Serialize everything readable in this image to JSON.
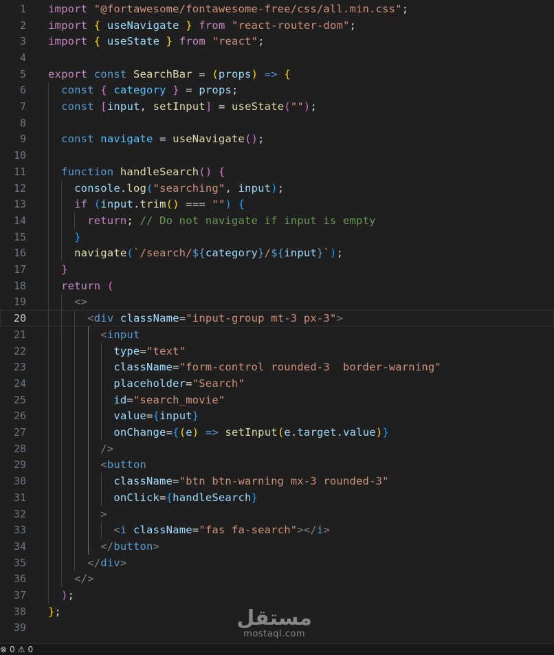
{
  "colors": {
    "keyword": "#c586c0",
    "storage": "#569cd6",
    "string": "#ce9178",
    "func": "#dcdcaa",
    "variable": "#9cdcfe",
    "constant": "#4fc1ff",
    "component": "#4ec9b0",
    "comment": "#6a9955",
    "punct": "#d4d4d4",
    "tag": "#808080",
    "bracket1": "#ffd700",
    "bracket2": "#da70d6",
    "bracket3": "#179fff",
    "attr": "#9cdcfe"
  },
  "lines": [
    {
      "n": "1",
      "t": [
        [
          "kw",
          "import"
        ],
        [
          "p",
          " "
        ],
        [
          "s",
          "\"@fortawesome/fontawesome-free/css/all.min.css\""
        ],
        [
          "p",
          ";"
        ]
      ]
    },
    {
      "n": "2",
      "t": [
        [
          "kw",
          "import"
        ],
        [
          "p",
          " "
        ],
        [
          "b1",
          "{"
        ],
        [
          "p",
          " "
        ],
        [
          "v",
          "useNavigate"
        ],
        [
          "p",
          " "
        ],
        [
          "b1",
          "}"
        ],
        [
          "p",
          " "
        ],
        [
          "kw",
          "from"
        ],
        [
          "p",
          " "
        ],
        [
          "s",
          "\"react-router-dom\""
        ],
        [
          "p",
          ";"
        ]
      ]
    },
    {
      "n": "3",
      "t": [
        [
          "kw",
          "import"
        ],
        [
          "p",
          " "
        ],
        [
          "b1",
          "{"
        ],
        [
          "p",
          " "
        ],
        [
          "v",
          "useState"
        ],
        [
          "p",
          " "
        ],
        [
          "b1",
          "}"
        ],
        [
          "p",
          " "
        ],
        [
          "kw",
          "from"
        ],
        [
          "p",
          " "
        ],
        [
          "s",
          "\"react\""
        ],
        [
          "p",
          ";"
        ]
      ]
    },
    {
      "n": "4",
      "t": []
    },
    {
      "n": "5",
      "t": [
        [
          "kw",
          "export"
        ],
        [
          "p",
          " "
        ],
        [
          "st",
          "const"
        ],
        [
          "p",
          " "
        ],
        [
          "fn",
          "SearchBar"
        ],
        [
          "p",
          " = "
        ],
        [
          "b1",
          "("
        ],
        [
          "v",
          "props"
        ],
        [
          "b1",
          ")"
        ],
        [
          "p",
          " "
        ],
        [
          "st",
          "=>"
        ],
        [
          "p",
          " "
        ],
        [
          "b1",
          "{"
        ]
      ]
    },
    {
      "n": "6",
      "t": [
        [
          "p",
          "  "
        ],
        [
          "st",
          "const"
        ],
        [
          "p",
          " "
        ],
        [
          "b2",
          "{"
        ],
        [
          "p",
          " "
        ],
        [
          "c",
          "category"
        ],
        [
          "p",
          " "
        ],
        [
          "b2",
          "}"
        ],
        [
          "p",
          " = "
        ],
        [
          "v",
          "props"
        ],
        [
          "p",
          ";"
        ]
      ]
    },
    {
      "n": "7",
      "t": [
        [
          "p",
          "  "
        ],
        [
          "st",
          "const"
        ],
        [
          "p",
          " "
        ],
        [
          "b2",
          "["
        ],
        [
          "v",
          "input"
        ],
        [
          "p",
          ", "
        ],
        [
          "fn",
          "setInput"
        ],
        [
          "b2",
          "]"
        ],
        [
          "p",
          " = "
        ],
        [
          "fn",
          "useState"
        ],
        [
          "b2",
          "("
        ],
        [
          "s",
          "\"\""
        ],
        [
          "b2",
          ")"
        ],
        [
          "p",
          ";"
        ]
      ]
    },
    {
      "n": "8",
      "t": []
    },
    {
      "n": "9",
      "t": [
        [
          "p",
          "  "
        ],
        [
          "st",
          "const"
        ],
        [
          "p",
          " "
        ],
        [
          "c",
          "navigate"
        ],
        [
          "p",
          " = "
        ],
        [
          "fn",
          "useNavigate"
        ],
        [
          "b2",
          "()"
        ],
        [
          "p",
          ";"
        ]
      ]
    },
    {
      "n": "10",
      "t": []
    },
    {
      "n": "11",
      "t": [
        [
          "p",
          "  "
        ],
        [
          "st",
          "function"
        ],
        [
          "p",
          " "
        ],
        [
          "fn",
          "handleSearch"
        ],
        [
          "b2",
          "()"
        ],
        [
          "p",
          " "
        ],
        [
          "b2",
          "{"
        ]
      ]
    },
    {
      "n": "12",
      "t": [
        [
          "p",
          "    "
        ],
        [
          "v",
          "console"
        ],
        [
          "p",
          "."
        ],
        [
          "fn",
          "log"
        ],
        [
          "b3",
          "("
        ],
        [
          "s",
          "\"searching\""
        ],
        [
          "p",
          ", "
        ],
        [
          "v",
          "input"
        ],
        [
          "b3",
          ")"
        ],
        [
          "p",
          ";"
        ]
      ]
    },
    {
      "n": "13",
      "t": [
        [
          "p",
          "    "
        ],
        [
          "kw",
          "if"
        ],
        [
          "p",
          " "
        ],
        [
          "b3",
          "("
        ],
        [
          "v",
          "input"
        ],
        [
          "p",
          "."
        ],
        [
          "fn",
          "trim"
        ],
        [
          "b1",
          "()"
        ],
        [
          "p",
          " === "
        ],
        [
          "s",
          "\"\""
        ],
        [
          "b3",
          ")"
        ],
        [
          "p",
          " "
        ],
        [
          "b3",
          "{"
        ]
      ]
    },
    {
      "n": "14",
      "t": [
        [
          "p",
          "      "
        ],
        [
          "kw",
          "return"
        ],
        [
          "p",
          "; "
        ],
        [
          "cm",
          "// Do not navigate if input is empty"
        ]
      ]
    },
    {
      "n": "15",
      "t": [
        [
          "p",
          "    "
        ],
        [
          "b3",
          "}"
        ]
      ]
    },
    {
      "n": "16",
      "t": [
        [
          "p",
          "    "
        ],
        [
          "fn",
          "navigate"
        ],
        [
          "b3",
          "("
        ],
        [
          "s",
          "`/search/"
        ],
        [
          "st",
          "${"
        ],
        [
          "v",
          "category"
        ],
        [
          "st",
          "}"
        ],
        [
          "s",
          "/"
        ],
        [
          "st",
          "${"
        ],
        [
          "v",
          "input"
        ],
        [
          "st",
          "}"
        ],
        [
          "s",
          "`"
        ],
        [
          "b3",
          ")"
        ],
        [
          "p",
          ";"
        ]
      ]
    },
    {
      "n": "17",
      "t": [
        [
          "p",
          "  "
        ],
        [
          "b2",
          "}"
        ]
      ]
    },
    {
      "n": "18",
      "t": [
        [
          "p",
          "  "
        ],
        [
          "kw",
          "return"
        ],
        [
          "p",
          " "
        ],
        [
          "b2",
          "("
        ]
      ]
    },
    {
      "n": "19",
      "t": [
        [
          "p",
          "    "
        ],
        [
          "tg",
          "<>"
        ]
      ]
    },
    {
      "n": "20",
      "t": [
        [
          "p",
          "      "
        ],
        [
          "tg",
          "<"
        ],
        [
          "st",
          "div"
        ],
        [
          "p",
          " "
        ],
        [
          "at",
          "className"
        ],
        [
          "p",
          "="
        ],
        [
          "s",
          "\"input-group mt-3 px-3\""
        ],
        [
          "tg",
          ">"
        ]
      ],
      "active": true
    },
    {
      "n": "21",
      "t": [
        [
          "p",
          "        "
        ],
        [
          "tg",
          "<"
        ],
        [
          "st",
          "input"
        ]
      ]
    },
    {
      "n": "22",
      "t": [
        [
          "p",
          "          "
        ],
        [
          "at",
          "type"
        ],
        [
          "p",
          "="
        ],
        [
          "s",
          "\"text\""
        ]
      ]
    },
    {
      "n": "23",
      "t": [
        [
          "p",
          "          "
        ],
        [
          "at",
          "className"
        ],
        [
          "p",
          "="
        ],
        [
          "s",
          "\"form-control rounded-3  border-warning\""
        ]
      ]
    },
    {
      "n": "24",
      "t": [
        [
          "p",
          "          "
        ],
        [
          "at",
          "placeholder"
        ],
        [
          "p",
          "="
        ],
        [
          "s",
          "\"Search\""
        ]
      ]
    },
    {
      "n": "25",
      "t": [
        [
          "p",
          "          "
        ],
        [
          "at",
          "id"
        ],
        [
          "p",
          "="
        ],
        [
          "s",
          "\"search_movie\""
        ]
      ]
    },
    {
      "n": "26",
      "t": [
        [
          "p",
          "          "
        ],
        [
          "at",
          "value"
        ],
        [
          "p",
          "="
        ],
        [
          "b3",
          "{"
        ],
        [
          "v",
          "input"
        ],
        [
          "b3",
          "}"
        ]
      ]
    },
    {
      "n": "27",
      "t": [
        [
          "p",
          "          "
        ],
        [
          "at",
          "onChange"
        ],
        [
          "p",
          "="
        ],
        [
          "b3",
          "{"
        ],
        [
          "b1",
          "("
        ],
        [
          "v",
          "e"
        ],
        [
          "b1",
          ")"
        ],
        [
          "p",
          " "
        ],
        [
          "st",
          "=>"
        ],
        [
          "p",
          " "
        ],
        [
          "fn",
          "setInput"
        ],
        [
          "b1",
          "("
        ],
        [
          "v",
          "e"
        ],
        [
          "p",
          "."
        ],
        [
          "v",
          "target"
        ],
        [
          "p",
          "."
        ],
        [
          "v",
          "value"
        ],
        [
          "b1",
          ")"
        ],
        [
          "b3",
          "}"
        ]
      ]
    },
    {
      "n": "28",
      "t": [
        [
          "p",
          "        "
        ],
        [
          "tg",
          "/>"
        ]
      ]
    },
    {
      "n": "29",
      "t": [
        [
          "p",
          "        "
        ],
        [
          "tg",
          "<"
        ],
        [
          "st",
          "button"
        ]
      ]
    },
    {
      "n": "30",
      "t": [
        [
          "p",
          "          "
        ],
        [
          "at",
          "className"
        ],
        [
          "p",
          "="
        ],
        [
          "s",
          "\"btn btn-warning mx-3 rounded-3\""
        ]
      ]
    },
    {
      "n": "31",
      "t": [
        [
          "p",
          "          "
        ],
        [
          "at",
          "onClick"
        ],
        [
          "p",
          "="
        ],
        [
          "b3",
          "{"
        ],
        [
          "v",
          "handleSearch"
        ],
        [
          "b3",
          "}"
        ]
      ]
    },
    {
      "n": "32",
      "t": [
        [
          "p",
          "        "
        ],
        [
          "tg",
          ">"
        ]
      ]
    },
    {
      "n": "33",
      "t": [
        [
          "p",
          "          "
        ],
        [
          "tg",
          "<"
        ],
        [
          "st",
          "i"
        ],
        [
          "p",
          " "
        ],
        [
          "at",
          "className"
        ],
        [
          "p",
          "="
        ],
        [
          "s",
          "\"fas fa-search\""
        ],
        [
          "tg",
          "></"
        ],
        [
          "st",
          "i"
        ],
        [
          "tg",
          ">"
        ]
      ]
    },
    {
      "n": "34",
      "t": [
        [
          "p",
          "        "
        ],
        [
          "tg",
          "</"
        ],
        [
          "st",
          "button"
        ],
        [
          "tg",
          ">"
        ]
      ]
    },
    {
      "n": "35",
      "t": [
        [
          "p",
          "      "
        ],
        [
          "tg",
          "</"
        ],
        [
          "st",
          "div"
        ],
        [
          "tg",
          ">"
        ]
      ]
    },
    {
      "n": "36",
      "t": [
        [
          "p",
          "    "
        ],
        [
          "tg",
          "</>"
        ]
      ]
    },
    {
      "n": "37",
      "t": [
        [
          "p",
          "  "
        ],
        [
          "b2",
          ")"
        ],
        [
          "p",
          ";"
        ]
      ]
    },
    {
      "n": "38",
      "t": [
        [
          "b1",
          "}"
        ],
        [
          "p",
          ";"
        ]
      ]
    },
    {
      "n": "39",
      "t": []
    }
  ],
  "status": {
    "errors_icon": "x-circle-icon",
    "errors": "0",
    "warnings_icon": "warning-icon",
    "warnings": "0"
  },
  "watermark": {
    "arabic": "مستقل",
    "latin": "mostaql.com"
  }
}
